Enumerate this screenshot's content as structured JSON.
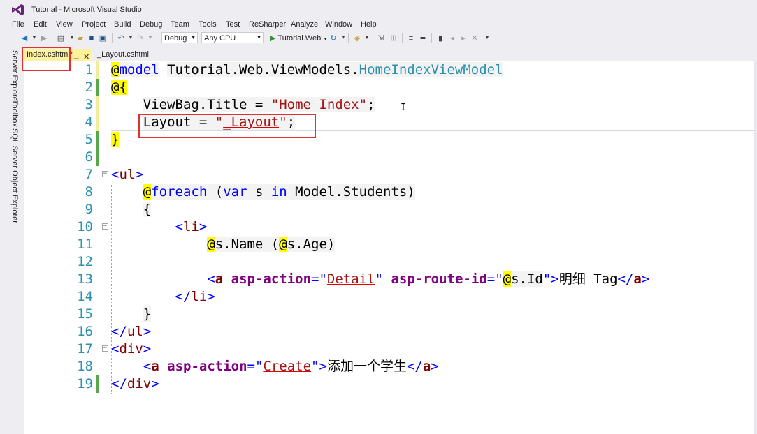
{
  "window": {
    "title": "Tutorial - Microsoft Visual Studio"
  },
  "menu": [
    "File",
    "Edit",
    "View",
    "Project",
    "Build",
    "Debug",
    "Team",
    "Tools",
    "Test",
    "ReSharper",
    "Analyze",
    "Window",
    "Help"
  ],
  "toolbar": {
    "config": "Debug",
    "platform": "Any CPU",
    "run_label": "Tutorial.Web"
  },
  "side_panels": [
    "Server Explorer",
    "Toolbox",
    "SQL Server Object Explorer"
  ],
  "tabs": {
    "active": "Index.cshtml*",
    "inactive": "_Layout.cshtml"
  },
  "code": {
    "line_numbers": [
      "1",
      "2",
      "3",
      "4",
      "5",
      "6",
      "7",
      "8",
      "9",
      "10",
      "11",
      "12",
      "13",
      "14",
      "15",
      "16",
      "17",
      "18",
      "19"
    ],
    "l1": {
      "dir": "model",
      "type_ns": "Tutorial.Web.ViewModels.",
      "type_name": "HomeIndexViewModel"
    },
    "l2": {
      "open": "{"
    },
    "l3": {
      "lhs": "ViewBag.Title = ",
      "value": "\"Home Index\"",
      "end": ";"
    },
    "l4": {
      "lhs": "Layout = ",
      "q1": "\"",
      "value": "_Layout",
      "q2": "\"",
      "end": ";"
    },
    "l5": {
      "close": "}"
    },
    "l7": {
      "tag": "ul"
    },
    "l8": {
      "kw": "foreach",
      "p1": " (",
      "var": "var",
      "mid": " s ",
      "in": "in",
      "rest": " Model.Students)"
    },
    "l9": {
      "text": "{"
    },
    "l10": {
      "tag": "li"
    },
    "l11": {
      "a": "s.Name (",
      "b": "s.Age)"
    },
    "l13": {
      "tag": "a",
      "attr1": "asp-action",
      "val1": "Detail",
      "attr2": "asp-route-id",
      "val2": "s.Id",
      "text": "明细 Tag"
    },
    "l14": {
      "tag": "li"
    },
    "l15": {
      "text": "}"
    },
    "l16": {
      "tag": "ul"
    },
    "l17": {
      "tag": "div"
    },
    "l18": {
      "tag": "a",
      "attr1": "asp-action",
      "val1": "Create",
      "text": "添加一个学生"
    },
    "l19": {
      "tag": "div"
    }
  },
  "colors": {
    "tab_active_bg": "#fff29d",
    "highlight_box": "#e03030",
    "razor_at": "#ffff00",
    "line_number": "#2b91af",
    "keyword": "#0000ff",
    "string": "#a31515",
    "html_tag": "#800000",
    "attribute": "#800080"
  }
}
